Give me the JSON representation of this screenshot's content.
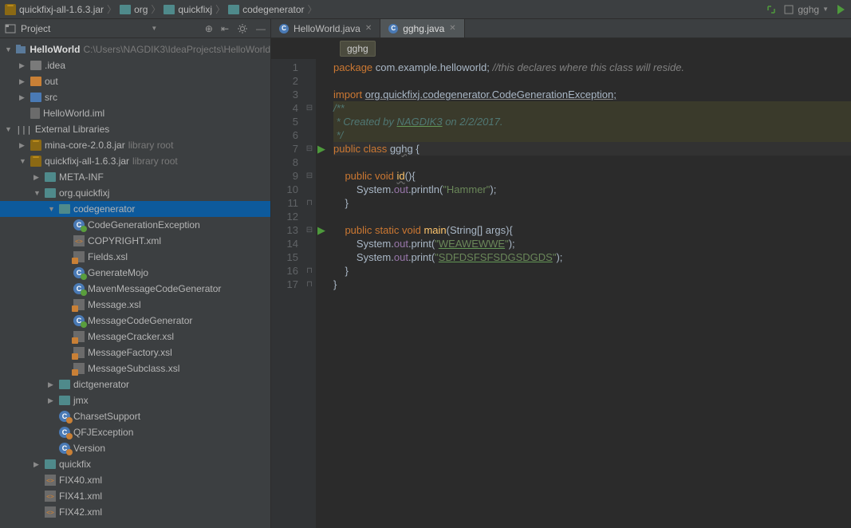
{
  "breadcrumb": [
    "quickfixj-all-1.6.3.jar",
    "org",
    "quickfixj",
    "codegenerator"
  ],
  "navSelector": "gghg",
  "toolWindow": {
    "title": "Project"
  },
  "tabs": [
    {
      "label": "HelloWorld.java",
      "active": false
    },
    {
      "label": "gghg.java",
      "active": true
    }
  ],
  "editorCrumb": "gghg",
  "tree": [
    {
      "d": 0,
      "a": "down",
      "ic": "root",
      "t": "HelloWorld",
      "muted": "C:\\Users\\NAGDIK3\\IdeaProjects\\HelloWorld",
      "bold": true
    },
    {
      "d": 1,
      "a": "right",
      "ic": "folder-gray",
      "t": ".idea"
    },
    {
      "d": 1,
      "a": "right",
      "ic": "folder-orange",
      "t": "out"
    },
    {
      "d": 1,
      "a": "right",
      "ic": "folder-blue",
      "t": "src"
    },
    {
      "d": 1,
      "a": "",
      "ic": "file",
      "t": "HelloWorld.iml"
    },
    {
      "d": 0,
      "a": "down",
      "ic": "lib",
      "t": "External Libraries"
    },
    {
      "d": 1,
      "a": "right",
      "ic": "jar",
      "t": "mina-core-2.0.8.jar",
      "muted": "library root"
    },
    {
      "d": 1,
      "a": "down",
      "ic": "jar",
      "t": "quickfixj-all-1.6.3.jar",
      "muted": "library root"
    },
    {
      "d": 2,
      "a": "right",
      "ic": "folder-teal",
      "t": "META-INF"
    },
    {
      "d": 2,
      "a": "down",
      "ic": "folder-teal",
      "t": "org.quickfixj"
    },
    {
      "d": 3,
      "a": "down",
      "ic": "folder-teal",
      "t": "codegenerator",
      "sel": true
    },
    {
      "d": 4,
      "a": "",
      "ic": "class-g",
      "t": "CodeGenerationException"
    },
    {
      "d": 4,
      "a": "",
      "ic": "xml",
      "t": "COPYRIGHT.xml"
    },
    {
      "d": 4,
      "a": "",
      "ic": "xsl",
      "t": "Fields.xsl"
    },
    {
      "d": 4,
      "a": "",
      "ic": "class-g",
      "t": "GenerateMojo"
    },
    {
      "d": 4,
      "a": "",
      "ic": "class-g",
      "t": "MavenMessageCodeGenerator"
    },
    {
      "d": 4,
      "a": "",
      "ic": "xsl",
      "t": "Message.xsl"
    },
    {
      "d": 4,
      "a": "",
      "ic": "class-g",
      "t": "MessageCodeGenerator"
    },
    {
      "d": 4,
      "a": "",
      "ic": "xsl",
      "t": "MessageCracker.xsl"
    },
    {
      "d": 4,
      "a": "",
      "ic": "xsl",
      "t": "MessageFactory.xsl"
    },
    {
      "d": 4,
      "a": "",
      "ic": "xsl",
      "t": "MessageSubclass.xsl"
    },
    {
      "d": 3,
      "a": "right",
      "ic": "folder-teal",
      "t": "dictgenerator"
    },
    {
      "d": 3,
      "a": "right",
      "ic": "folder-teal",
      "t": "jmx"
    },
    {
      "d": 3,
      "a": "",
      "ic": "class-o",
      "t": "CharsetSupport"
    },
    {
      "d": 3,
      "a": "",
      "ic": "class-o",
      "t": "QFJException"
    },
    {
      "d": 3,
      "a": "",
      "ic": "class-o",
      "t": "Version"
    },
    {
      "d": 2,
      "a": "right",
      "ic": "folder-teal",
      "t": "quickfix"
    },
    {
      "d": 2,
      "a": "",
      "ic": "xml",
      "t": "FIX40.xml"
    },
    {
      "d": 2,
      "a": "",
      "ic": "xml",
      "t": "FIX41.xml"
    },
    {
      "d": 2,
      "a": "",
      "ic": "xml",
      "t": "FIX42.xml"
    }
  ],
  "code": {
    "lines": [
      {
        "n": 1,
        "mk": "",
        "ar": "",
        "html": "<span class='kw'>package</span> com.example.helloworld; <span class='cmt'>//this declares where this class will reside.</span>"
      },
      {
        "n": 2,
        "mk": "",
        "ar": "",
        "html": ""
      },
      {
        "n": 3,
        "mk": "",
        "ar": "",
        "html": "<span class='kw'>import</span> <span class='under-b'>org.quickfixj.codegenerator.CodeGenerationException;</span>"
      },
      {
        "n": 4,
        "mk": "⊟",
        "ar": "",
        "html": "<span class='ann'>/**</span>",
        "hl": true
      },
      {
        "n": 5,
        "mk": "",
        "ar": "",
        "html": "<span class='ann'> * Created by <span class='under-g'>NAGDIK3</span> on 2/2/2017.</span>",
        "hl": true
      },
      {
        "n": 6,
        "mk": "",
        "ar": "",
        "html": "<span class='ann'> */</span>",
        "hl": true
      },
      {
        "n": 7,
        "mk": "⊟",
        "ar": "run",
        "html": "<span class='kw'>public class</span> <span class='under'>gghg</span> {",
        "cur": true
      },
      {
        "n": 8,
        "mk": "",
        "ar": "",
        "html": ""
      },
      {
        "n": 9,
        "mk": "⊟",
        "ar": "",
        "html": "    <span class='kw'>public void</span> <span class='ident under'>id</span>(){"
      },
      {
        "n": 10,
        "mk": "",
        "ar": "",
        "html": "        System.<span class='field'>out</span>.println(<span class='str'>\"Hammer\"</span>);"
      },
      {
        "n": 11,
        "mk": "⊓",
        "ar": "",
        "html": "    }"
      },
      {
        "n": 12,
        "mk": "",
        "ar": "",
        "html": ""
      },
      {
        "n": 13,
        "mk": "⊟",
        "ar": "run",
        "html": "    <span class='kw'>public static void</span> <span class='ident'>main</span>(String[] args){"
      },
      {
        "n": 14,
        "mk": "",
        "ar": "",
        "html": "        System.<span class='field'>out</span>.print(<span class='str'>\"<span class='under-g'>WEAWEWWE</span>\"</span>);"
      },
      {
        "n": 15,
        "mk": "",
        "ar": "",
        "html": "        System.<span class='field'>out</span>.print(<span class='str'>\"<span class='under-g'>SDFDSFSFSDGSDGDS</span>\"</span>);"
      },
      {
        "n": 16,
        "mk": "⊓",
        "ar": "",
        "html": "    }"
      },
      {
        "n": 17,
        "mk": "⊓",
        "ar": "",
        "html": "}"
      }
    ]
  }
}
